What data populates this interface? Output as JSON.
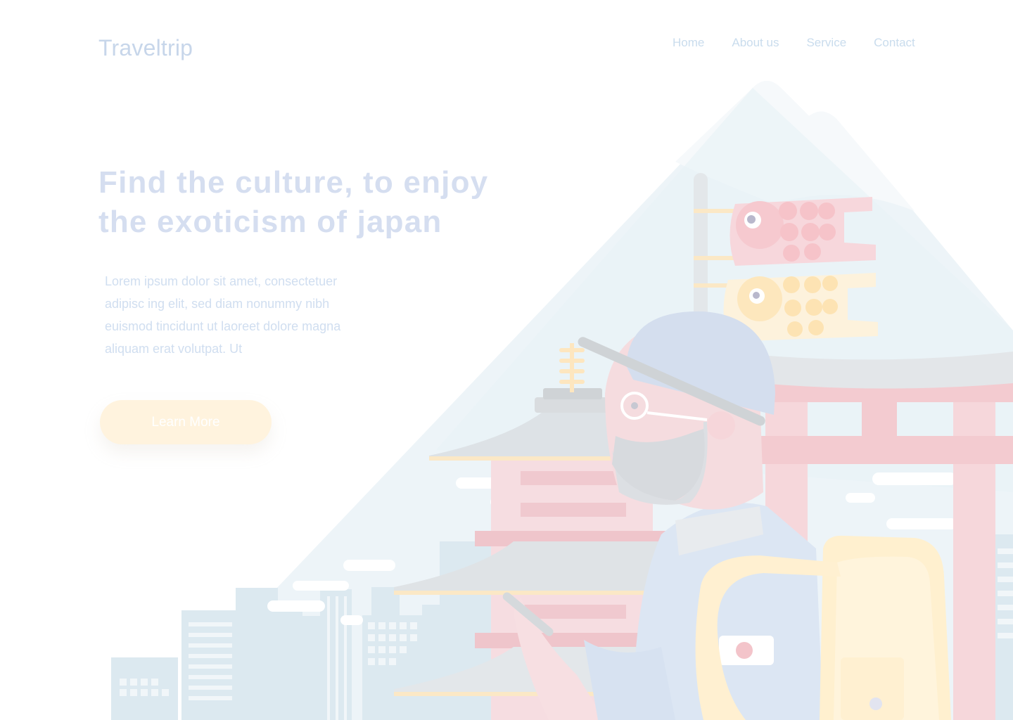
{
  "brand": {
    "name": "Traveltrip"
  },
  "nav": {
    "items": [
      {
        "label": "Home"
      },
      {
        "label": "About us"
      },
      {
        "label": "Service"
      },
      {
        "label": "Contact"
      }
    ]
  },
  "hero": {
    "title_line1": "Find the culture, to enjoy",
    "title_line2": "the exoticism of japan",
    "body": [
      "Lorem ipsum dolor sit amet, consectetuer",
      "adipisc ing elit, sed diam nonummy nibh",
      "euismod tincidunt ut laoreet dolore magna",
      "aliquam erat volutpat. Ut"
    ],
    "cta_label": "Learn More"
  },
  "illustration": {
    "subject": "traveler with backpack in front of mount fuji, pagoda, torii gate, koinobori and city skyline",
    "colors": {
      "mountain": "#eaf2f7",
      "torii": "#f5d8dc",
      "backpack": "#fff0cf",
      "jacket": "#dbe6f3",
      "buildings": "#dfeaf1"
    }
  }
}
